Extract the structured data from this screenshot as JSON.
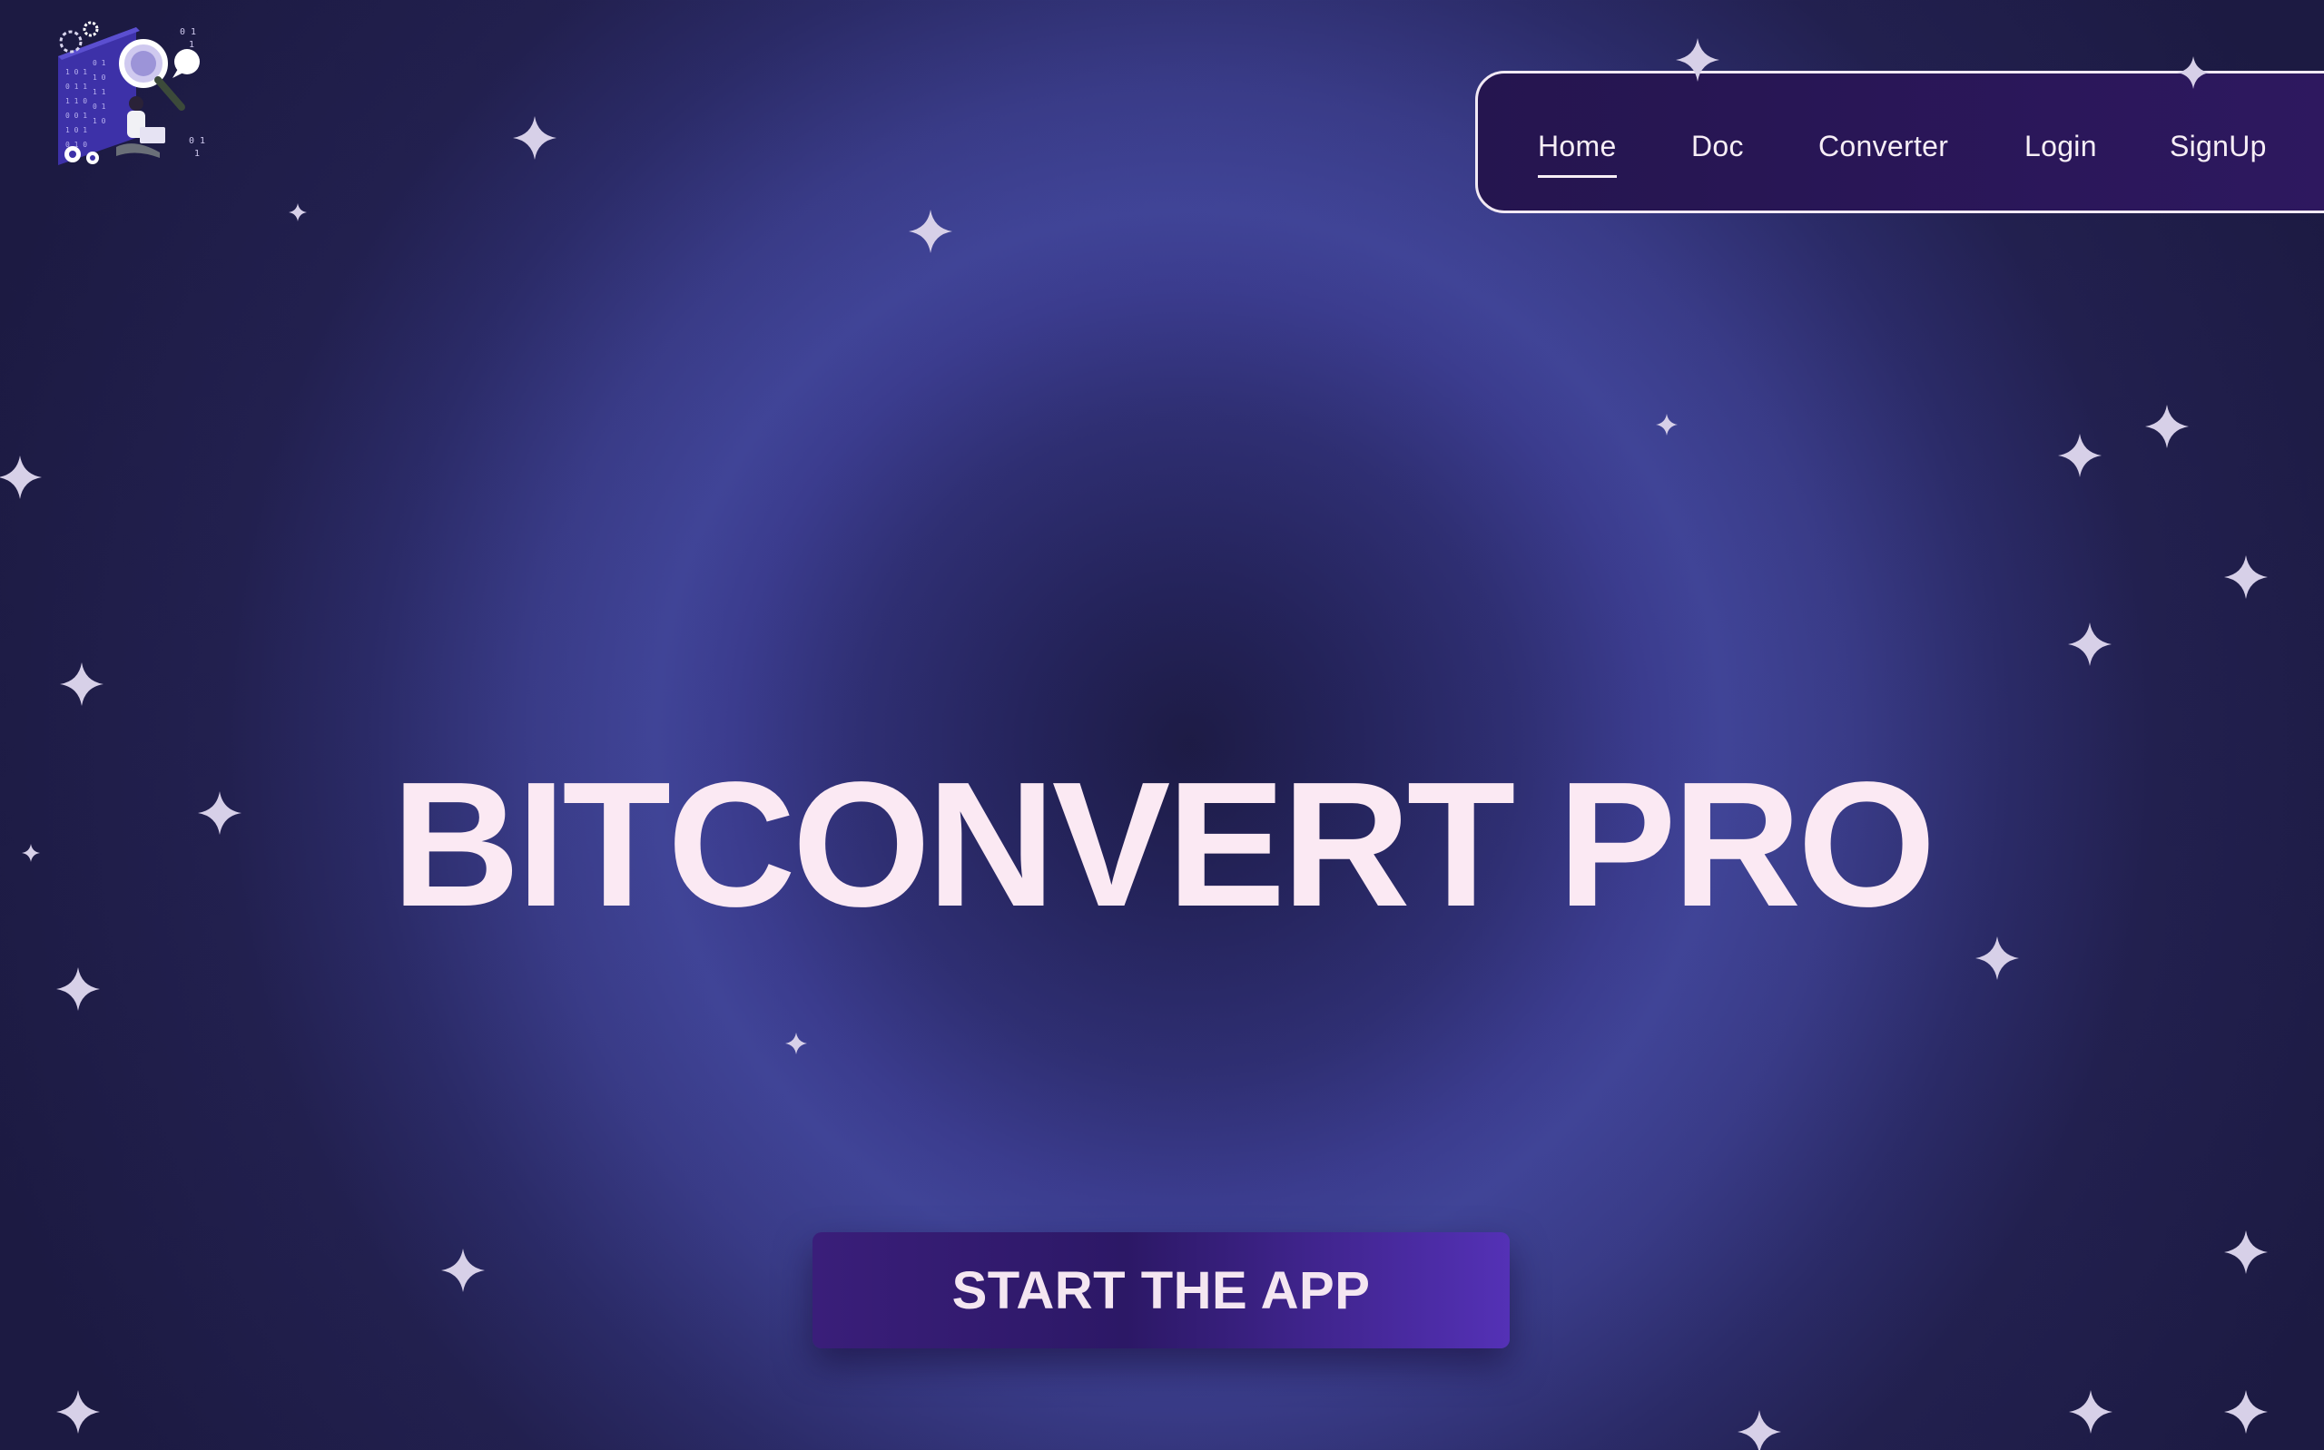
{
  "brand": {
    "logo_icon": "data-analysis-illustration-icon"
  },
  "nav": {
    "items": [
      {
        "label": "Home",
        "active": true
      },
      {
        "label": "Doc",
        "active": false
      },
      {
        "label": "Converter",
        "active": false
      },
      {
        "label": "Login",
        "active": false
      },
      {
        "label": "SignUp",
        "active": false
      }
    ]
  },
  "hero": {
    "title": "BITCONVERT PRO",
    "cta_label": "START THE APP"
  },
  "decor": {
    "star_icon": "sparkle-star-icon"
  },
  "colors": {
    "background_light": "#404497",
    "background_dark": "#1c1a42",
    "nav_bg": "#2a175a",
    "title_text": "#fbe9f3",
    "cta_bg": "#3a1e7a",
    "cta_accent": "#5431b6",
    "star": "#d7d0e8"
  }
}
